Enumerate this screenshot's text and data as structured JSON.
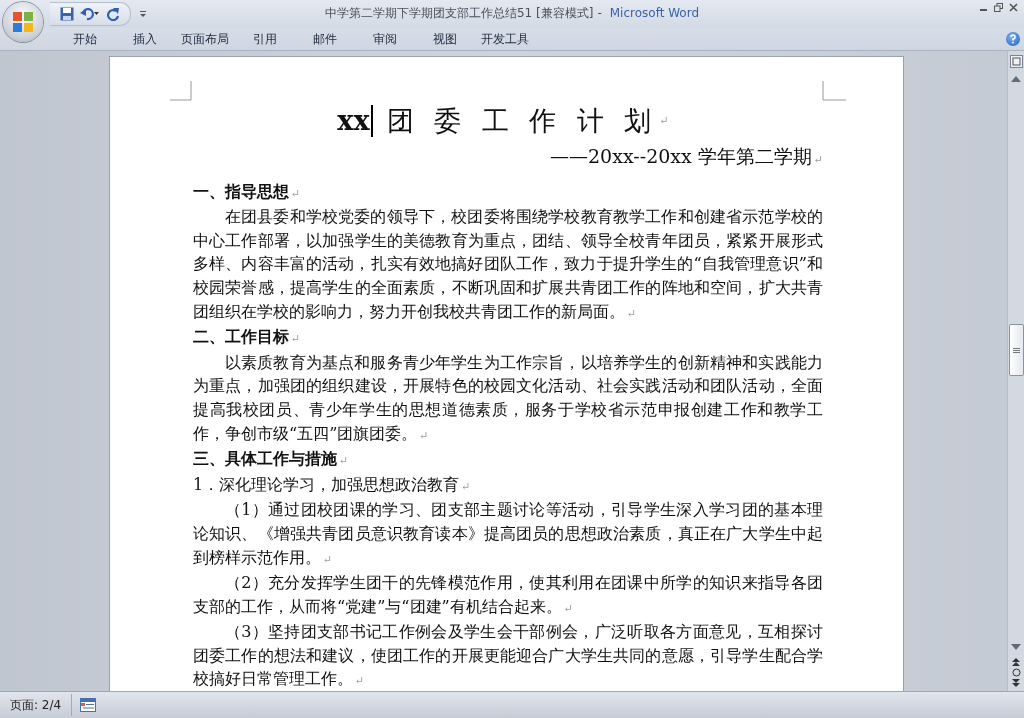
{
  "window": {
    "title": "中学第二学期下学期团支部工作总结51 [兼容模式]",
    "separator": "-",
    "app_name": "Microsoft Word"
  },
  "tabs": [
    {
      "label": "开始",
      "selected": false
    },
    {
      "label": "插入",
      "selected": false
    },
    {
      "label": "页面布局",
      "selected": false
    },
    {
      "label": "引用",
      "selected": false
    },
    {
      "label": "邮件",
      "selected": false
    },
    {
      "label": "审阅",
      "selected": false
    },
    {
      "label": "视图",
      "selected": false
    },
    {
      "label": "开发工具",
      "selected": false
    }
  ],
  "document": {
    "title": {
      "before_cursor": "xx",
      "after_cursor": "团 委 工 作 计 划",
      "mark": "↵"
    },
    "subtitle": {
      "text": "——20xx--20xx 学年第二学期",
      "mark": "↵"
    },
    "paragraphs": [
      {
        "kind": "heading",
        "text": "一、指导思想",
        "mark": "↵"
      },
      {
        "kind": "body",
        "text": "在团县委和学校党委的领导下，校团委将围绕学校教育教学工作和创建省示范学校的中心工作部署，以加强学生的美德教育为重点，团结、领导全校青年团员，紧紧开展形式多样、内容丰富的活动，扎实有效地搞好团队工作，致力于提升学生的“自我管理意识”和校园荣誉感，提高学生的全面素质，不断巩固和扩展共青团工作的阵地和空间，扩大共青团组织在学校的影响力，努力开创我校共青团工作的新局面。",
        "mark": "↵"
      },
      {
        "kind": "heading",
        "text": "二、工作目标",
        "mark": "↵"
      },
      {
        "kind": "body",
        "text": "以素质教育为基点和服务青少年学生为工作宗旨，以培养学生的创新精神和实践能力为重点，加强团的组织建设，开展特色的校园文化活动、社会实践活动和团队活动，全面提高我校团员、青少年学生的思想道德素质，服务于学校省示范申报创建工作和教学工作，争创市级“五四”团旗团委。",
        "mark": "↵"
      },
      {
        "kind": "heading",
        "text": "三、具体工作与措施",
        "mark": "↵"
      },
      {
        "kind": "plain",
        "text": "1．深化理论学习，加强思想政治教育",
        "mark": "↵"
      },
      {
        "kind": "body",
        "text": "（1）通过团校团课的学习、团支部主题讨论等活动，引导学生深入学习团的基本理论知识、《增强共青团员意识教育读本》提高团员的思想政治素质，真正在广大学生中起到榜样示范作用。",
        "mark": "↵"
      },
      {
        "kind": "body",
        "text": "（2）充分发挥学生团干的先锋模范作用，使其利用在团课中所学的知识来指导各团支部的工作，从而将“党建”与“团建”有机结合起来。",
        "mark": "↵"
      },
      {
        "kind": "body",
        "text": "（3）坚持团支部书记工作例会及学生会干部例会，广泛听取各方面意见，互相探讨团委工作的想法和建议，使团工作的开展更能迎合广大学生共同的意愿，引导学生配合学校搞好日常管理工作。",
        "mark": "↵"
      }
    ]
  },
  "status_bar": {
    "page": "页面: 2/4"
  }
}
